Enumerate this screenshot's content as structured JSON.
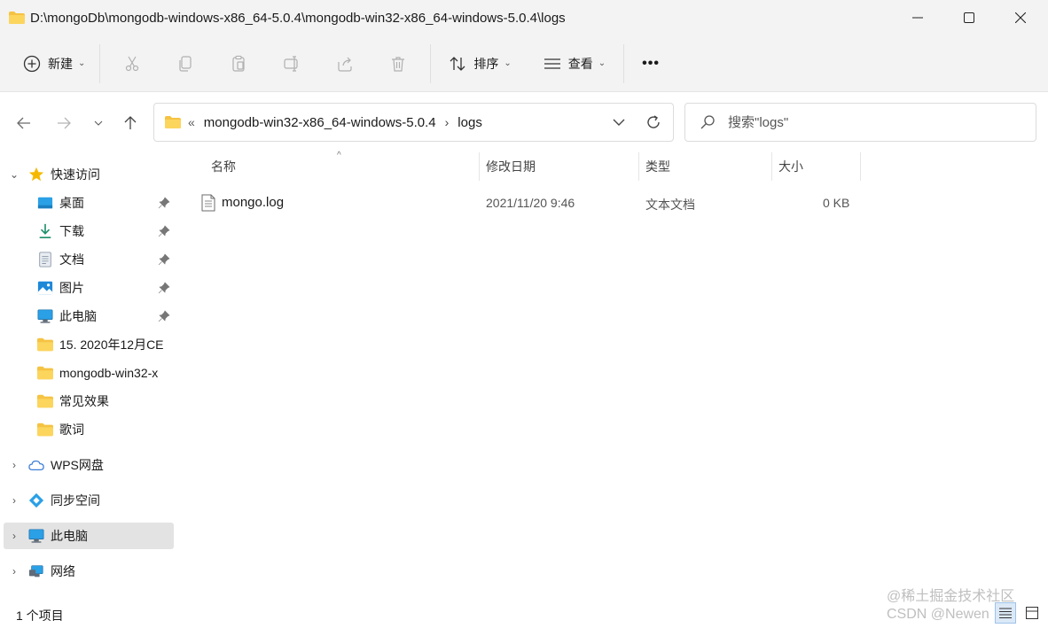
{
  "window": {
    "title": "D:\\mongoDb\\mongodb-windows-x86_64-5.0.4\\mongodb-win32-x86_64-windows-5.0.4\\logs",
    "icon": "folder-icon"
  },
  "toolbar": {
    "new_label": "新建",
    "sort_label": "排序",
    "view_label": "查看",
    "more_label": "•••"
  },
  "address": {
    "overflow": "«",
    "crumbs": [
      "mongodb-win32-x86_64-windows-5.0.4",
      "logs"
    ],
    "separator": "›"
  },
  "search": {
    "placeholder": "搜索\"logs\""
  },
  "sidebar": {
    "quick_access": "快速访问",
    "items": [
      {
        "label": "桌面",
        "icon": "desktop-icon",
        "pinned": true
      },
      {
        "label": "下载",
        "icon": "download-icon",
        "pinned": true
      },
      {
        "label": "文档",
        "icon": "document-icon",
        "pinned": true
      },
      {
        "label": "图片",
        "icon": "pictures-icon",
        "pinned": true
      },
      {
        "label": "此电脑",
        "icon": "monitor-icon",
        "pinned": true
      },
      {
        "label": "15. 2020年12月CE",
        "icon": "folder-icon",
        "pinned": false
      },
      {
        "label": "mongodb-win32-x",
        "icon": "folder-icon",
        "pinned": false
      },
      {
        "label": "常见效果",
        "icon": "folder-icon",
        "pinned": false
      },
      {
        "label": "歌词",
        "icon": "folder-icon",
        "pinned": false
      }
    ],
    "roots": [
      {
        "label": "WPS网盘",
        "icon": "cloud-icon"
      },
      {
        "label": "同步空间",
        "icon": "sync-icon"
      },
      {
        "label": "此电脑",
        "icon": "monitor-icon",
        "selected": true
      },
      {
        "label": "网络",
        "icon": "network-icon"
      }
    ]
  },
  "columns": {
    "name": "名称",
    "modified": "修改日期",
    "type": "类型",
    "size": "大小"
  },
  "files": [
    {
      "name": "mongo.log",
      "modified": "2021/11/20 9:46",
      "type": "文本文档",
      "size": "0 KB",
      "icon": "text-file-icon"
    }
  ],
  "status": {
    "count": "1 个项目"
  },
  "watermark": {
    "line1": "@稀土掘金技术社区",
    "line2": "CSDN @Newen"
  },
  "colors": {
    "folder": "#f5c343",
    "accent": "#0067c0",
    "selected_bg": "#e3e3e3"
  }
}
